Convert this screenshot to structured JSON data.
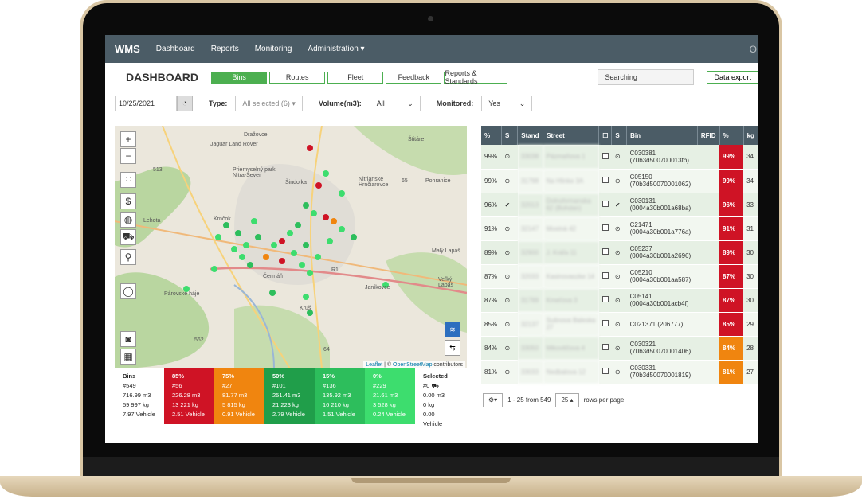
{
  "nav": {
    "brand": "WMS",
    "items": [
      "Dashboard",
      "Reports",
      "Monitoring",
      "Administration ▾"
    ]
  },
  "header": {
    "title": "DASHBOARD",
    "tabs": [
      "Bins",
      "Routes",
      "Fleet",
      "Feedback",
      "Reports & Standards"
    ],
    "active_tab": "Bins",
    "search_value": "Searching",
    "export_label": "Data export"
  },
  "filters": {
    "date": "10/25/2021",
    "type_label": "Type:",
    "type_value": "All selected (6) ▾",
    "volume_label": "Volume(m3):",
    "volume_value": "All",
    "monitored_label": "Monitored:",
    "monitored_value": "Yes"
  },
  "map": {
    "places": [
      "Dražovce",
      "Jaguar Land Rover",
      "Štitáre",
      "Priemyselný park Nitra-Sever",
      "Šindolka",
      "Nitrianske Hrnčiarovce",
      "Pohranice",
      "Lehota",
      "Krnčok",
      "Malý Lapáš",
      "Čermáň",
      "Veľký Lapáš",
      "Párovské háje",
      "Janíkovce",
      "Kruš",
      "562",
      "513",
      "65",
      "R1",
      "64"
    ],
    "attribution_leaflet": "Leaflet",
    "attribution_sep": " | © ",
    "attribution_osm": "OpenStreetMap",
    "attribution_tail": " contributors",
    "icons": [
      "zoom-in-icon",
      "zoom-out-icon",
      "fullscreen-icon",
      "moneybag-icon",
      "globe-icon",
      "truck-icon",
      "bin-icon",
      "lasso-icon",
      "screenshot-icon",
      "layout-icon"
    ]
  },
  "stats": {
    "total": {
      "title": "Bins",
      "count": "#549",
      "volume": "716.99 m3",
      "weight": "59 997 kg",
      "vehicles": "7.97 Vehicle"
    },
    "levels": [
      {
        "title": "85%",
        "count": "#56",
        "volume": "226.28 m3",
        "weight": "13 221 kg",
        "vehicles": "2.51 Vehicle",
        "color": "#cf1325"
      },
      {
        "title": "75%",
        "count": "#27",
        "volume": "81.77 m3",
        "weight": "5 815 kg",
        "vehicles": "0.91 Vehicle",
        "color": "#f0850f"
      },
      {
        "title": "50%",
        "count": "#101",
        "volume": "251.41 m3",
        "weight": "21 223 kg",
        "vehicles": "2.79 Vehicle",
        "color": "#209e4a"
      },
      {
        "title": "15%",
        "count": "#136",
        "volume": "135.92 m3",
        "weight": "16 210 kg",
        "vehicles": "1.51 Vehicle",
        "color": "#2dbe5c"
      },
      {
        "title": "0%",
        "count": "#229",
        "volume": "21.61 m3",
        "weight": "3 528 kg",
        "vehicles": "0.24 Vehicle",
        "color": "#3ddd6e"
      }
    ],
    "selected": {
      "title": "Selected",
      "count": "#0",
      "volume": "0.00 m3",
      "weight": "0 kg",
      "vehicles": "0.00 Vehicle"
    }
  },
  "table": {
    "columns": [
      "%",
      "S",
      "Stand",
      "Street",
      "☐",
      "S",
      "Bin",
      "RFID",
      "%",
      "kg"
    ],
    "rows": [
      {
        "pct": "99%",
        "s": "⊙",
        "stand": "33038",
        "street": "Pázmaňova 1",
        "s2": "⊙",
        "bin": "C030381",
        "bin2": "(70b3d500700013fb)",
        "pct2": "99%",
        "kg": "34",
        "color": "#cf1325"
      },
      {
        "pct": "99%",
        "s": "⊙",
        "stand": "31798",
        "street": "Na Hlinke 3A",
        "s2": "⊙",
        "bin": "C05150",
        "bin2": "(70b3d50070001062)",
        "pct2": "99%",
        "kg": "34",
        "color": "#cf1325"
      },
      {
        "pct": "96%",
        "s": "✔",
        "stand": "32013",
        "street": "Dolnohrmanska 62 (Bohdan)",
        "s2": "✔",
        "bin": "C030131",
        "bin2": "(0004a30b001a68ba)",
        "pct2": "96%",
        "kg": "33",
        "color": "#cf1325"
      },
      {
        "pct": "91%",
        "s": "⊙",
        "stand": "32147",
        "street": "Mostná 42",
        "s2": "⊙",
        "bin": "C21471",
        "bin2": "(0004a30b001a776a)",
        "pct2": "91%",
        "kg": "31",
        "color": "#cf1325"
      },
      {
        "pct": "89%",
        "s": "⊙",
        "stand": "32900",
        "street": "J. Kráľa 11",
        "s2": "⊙",
        "bin": "C05237",
        "bin2": "(0004a30b001a2696)",
        "pct2": "89%",
        "kg": "30",
        "color": "#cf1325"
      },
      {
        "pct": "87%",
        "s": "⊙",
        "stand": "32033",
        "street": "Kasinovaszke 14",
        "s2": "⊙",
        "bin": "C05210",
        "bin2": "(0004a30b001aa587)",
        "pct2": "87%",
        "kg": "30",
        "color": "#cf1325"
      },
      {
        "pct": "87%",
        "s": "⊙",
        "stand": "31799",
        "street": "Kmeťova 3",
        "s2": "⊙",
        "bin": "C05141",
        "bin2": "(0004a30b001acb4f)",
        "pct2": "87%",
        "kg": "30",
        "color": "#cf1325"
      },
      {
        "pct": "85%",
        "s": "⊙",
        "stand": "32137",
        "street": "Sušnova Baleska 27",
        "s2": "⊙",
        "bin": "C021371 (206777)",
        "bin2": "",
        "pct2": "85%",
        "kg": "29",
        "color": "#cf1325"
      },
      {
        "pct": "84%",
        "s": "⊙",
        "stand": "33050",
        "street": "Mikovtičova 4",
        "s2": "⊙",
        "bin": "C030321",
        "bin2": "(70b3d50070001406)",
        "pct2": "84%",
        "kg": "28",
        "color": "#f0850f"
      },
      {
        "pct": "81%",
        "s": "⊙",
        "stand": "33033",
        "street": "Nedbalova 12",
        "s2": "⊙",
        "bin": "C030331",
        "bin2": "(70b3d50070001819)",
        "pct2": "81%",
        "kg": "27",
        "color": "#f0850f"
      }
    ]
  },
  "pager": {
    "info": "1 - 25 from 549",
    "size": "25 ▴",
    "suffix": "rows per page"
  }
}
